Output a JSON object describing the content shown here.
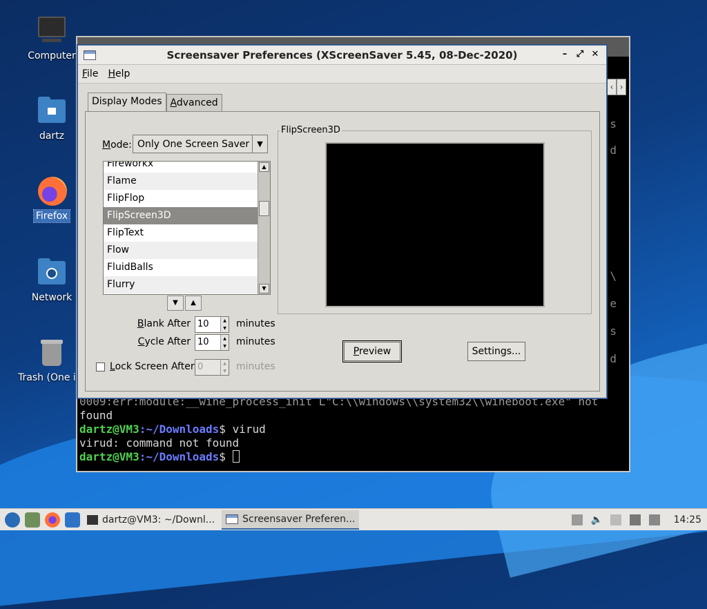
{
  "desktop": {
    "icons": [
      {
        "label": "Computer"
      },
      {
        "label": "dartz"
      },
      {
        "label": "Firefox"
      },
      {
        "label": "Network"
      },
      {
        "label": "Trash (One ite"
      }
    ]
  },
  "terminal": {
    "partial_line_1": "0009:err:module:__wine_process_init L\"C:\\\\windows\\\\system32\\\\wineboot.exe\" not",
    "partial_line_2": "found",
    "prompt_user": "dartz@VM3",
    "prompt_path": ":~/Downloads",
    "prompt_symbol": "$",
    "cmd1": " virud",
    "output1": "virud: command not found",
    "peek": [
      "s",
      "d",
      "\\",
      "e",
      "s",
      "d"
    ]
  },
  "dialog": {
    "title": "Screensaver Preferences  (XScreenSaver 5.45, 08-Dec-2020)",
    "window_buttons": {
      "minimize": "–",
      "maximize": "⤢",
      "close": "✕"
    },
    "menu": {
      "file_first": "F",
      "file_rest": "ile",
      "help_first": "H",
      "help_rest": "elp"
    },
    "tabs": {
      "display_modes": "Display Modes",
      "advanced_first": "A",
      "advanced_rest": "dvanced"
    },
    "mode": {
      "label_first": "M",
      "label_rest": "ode:",
      "value": "Only One Screen Saver"
    },
    "list": {
      "items": [
        "Fireworkx",
        "Flame",
        "FlipFlop",
        "FlipScreen3D",
        "FlipText",
        "Flow",
        "FluidBalls",
        "Flurry"
      ],
      "selected": "FlipScreen3D"
    },
    "blank_after": {
      "label_first": "B",
      "label_rest": "lank After",
      "value": "10",
      "unit": "minutes"
    },
    "cycle_after": {
      "label_first": "C",
      "label_rest": "ycle After",
      "value": "10",
      "unit": "minutes"
    },
    "lock_after": {
      "label_first": "L",
      "label_rest": "ock Screen After",
      "value": "0",
      "unit": "minutes",
      "checked": false
    },
    "preview_frame_label": "FlipScreen3D",
    "preview_button_first": "P",
    "preview_button_rest": "review",
    "settings_button": "Settings..."
  },
  "taskbar": {
    "tasks": [
      {
        "label": "dartz@VM3: ~/Downl..."
      },
      {
        "label": "Screensaver Preferen..."
      }
    ],
    "clock": "14:25"
  },
  "colors": {
    "selection": "#8b8a87",
    "accent": "#3465a4",
    "prompt_green": "#4fd14f",
    "prompt_blue": "#6b7cff"
  }
}
